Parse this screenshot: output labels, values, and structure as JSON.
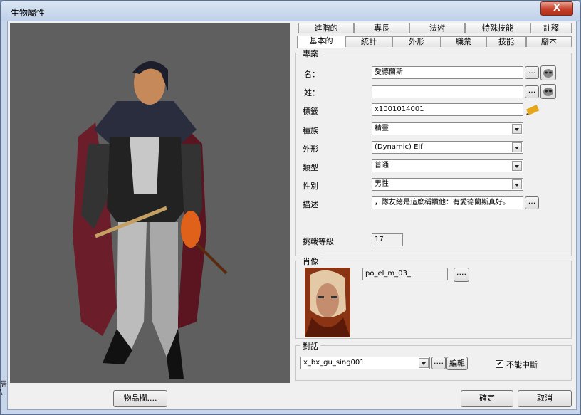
{
  "window": {
    "title": "生物屬性",
    "close_label": "X"
  },
  "tabs_row1": [
    "進階的",
    "專長",
    "法術",
    "特殊技能",
    "註釋"
  ],
  "tabs_row2": [
    "基本的",
    "統計",
    "外形",
    "職業",
    "技能",
    "腳本"
  ],
  "profile": {
    "group_label": "專案",
    "first_name": {
      "label": "名：",
      "value": "愛德蘭斯"
    },
    "last_name": {
      "label": "姓：",
      "value": ""
    },
    "tag": {
      "label": "標籤",
      "value": "x1001014001"
    },
    "race": {
      "label": "種族",
      "value": "精靈"
    },
    "appearance": {
      "label": "外形",
      "value": "(Dynamic) Elf"
    },
    "phenotype": {
      "label": "類型",
      "value": "普通"
    },
    "gender": {
      "label": "性別",
      "value": "男性"
    },
    "description": {
      "label": "描述",
      "value": "，隊友總是這麼稱讚他：有愛德蘭斯真好。"
    },
    "challenge": {
      "label": "挑戰等級",
      "value": "17"
    },
    "ellipsis": "..."
  },
  "portrait": {
    "group_label": "肖像",
    "value": "po_el_m_03_",
    "ellipsis": "...."
  },
  "conversation": {
    "group_label": "對話",
    "value": "x_bx_gu_sing001",
    "ellipsis": "....",
    "edit_label": "編輯",
    "no_interrupt_label": "不能中斷",
    "no_interrupt_checked": "✔"
  },
  "footer": {
    "inventory_label": "物品欄....",
    "ok_label": "確定",
    "cancel_label": "取消"
  },
  "edge": {
    "text": "居\n\\"
  }
}
